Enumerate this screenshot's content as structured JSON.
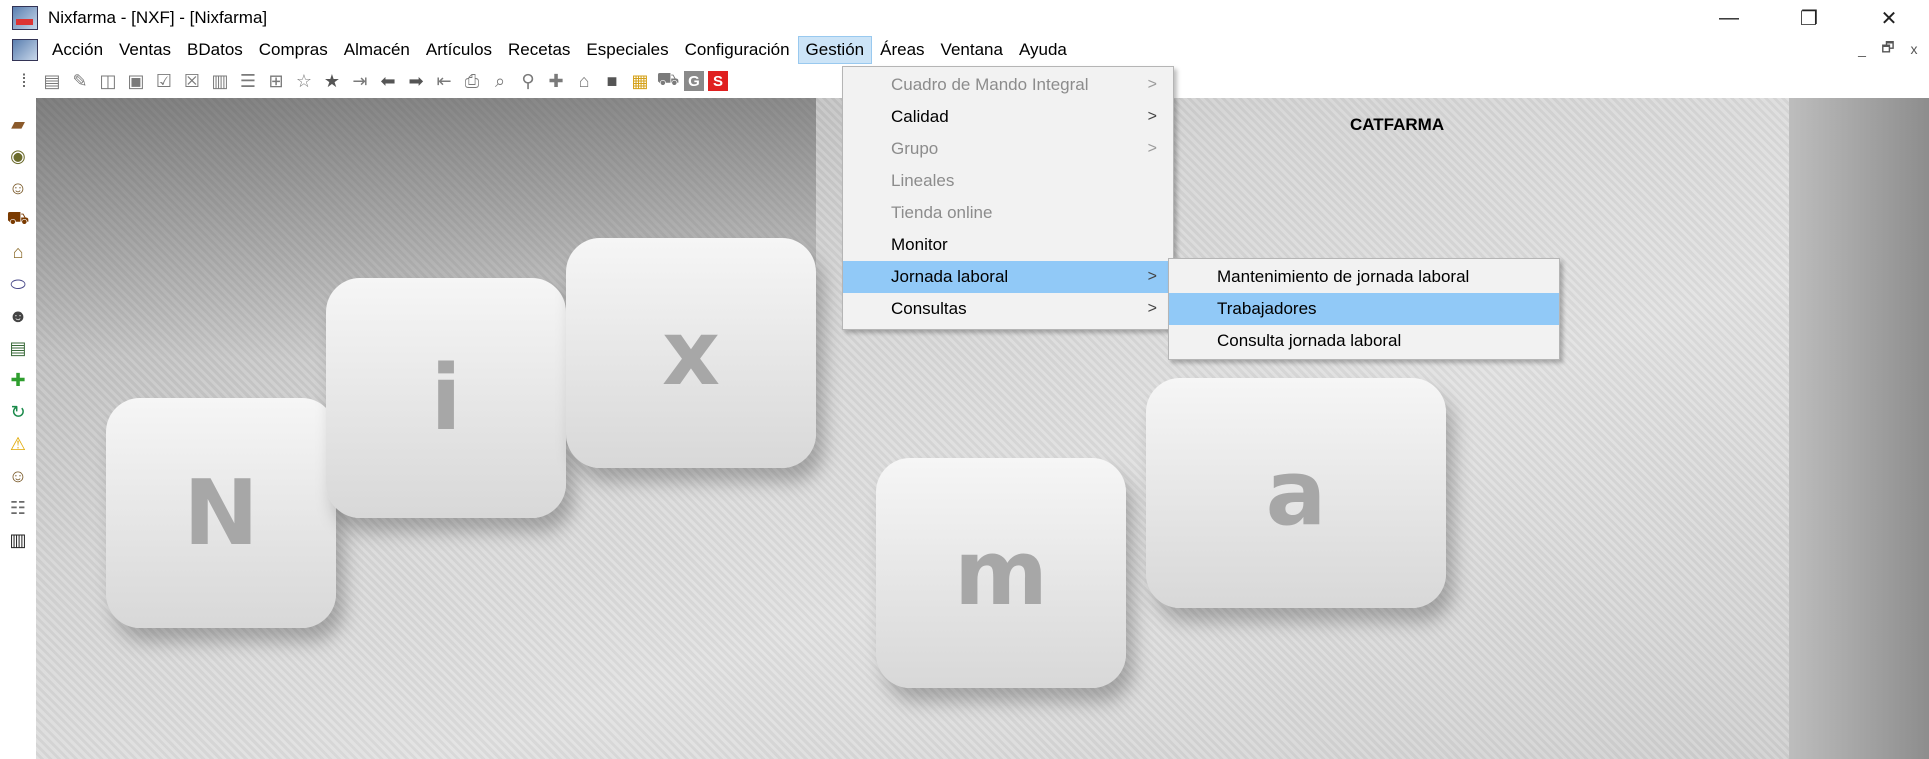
{
  "window": {
    "title": "Nixfarma - [NXF] - [Nixfarma]",
    "controls": {
      "minimize": "—",
      "restore": "❐",
      "close": "✕"
    }
  },
  "menubar": {
    "items": [
      "Acción",
      "Ventas",
      "BDatos",
      "Compras",
      "Almacén",
      "Artículos",
      "Recetas",
      "Especiales",
      "Configuración",
      "Gestión",
      "Áreas",
      "Ventana",
      "Ayuda"
    ],
    "active": "Gestión",
    "mdi_controls": {
      "minimize": "_",
      "restore": "🗗",
      "close": "x"
    }
  },
  "toolbar": {
    "g_label": "G",
    "s_label": "S"
  },
  "main": {
    "brand_label": "CATFARMA",
    "keys": [
      "N",
      "i",
      "x",
      "m",
      "a"
    ]
  },
  "gestion_menu": {
    "items": [
      {
        "label": "Cuadro de Mando Integral",
        "arrow": ">",
        "enabled": false
      },
      {
        "label": "Calidad",
        "arrow": ">",
        "enabled": true
      },
      {
        "label": "Grupo",
        "arrow": ">",
        "enabled": false
      },
      {
        "label": "Lineales",
        "arrow": "",
        "enabled": false
      },
      {
        "label": "Tienda online",
        "arrow": "",
        "enabled": false
      },
      {
        "label": "Monitor",
        "arrow": "",
        "enabled": true
      },
      {
        "label": "Jornada laboral",
        "arrow": ">",
        "enabled": true
      },
      {
        "label": "Consultas",
        "arrow": ">",
        "enabled": true
      }
    ],
    "highlighted": "Jornada laboral"
  },
  "jornada_submenu": {
    "items": [
      "Mantenimiento de jornada laboral",
      "Trabajadores",
      "Consulta jornada laboral"
    ],
    "highlighted": "Trabajadores"
  },
  "colors": {
    "menu_highlight": "#91c9f7",
    "menu_active": "#cce4f7",
    "menu_bg": "#f2f2f2"
  }
}
